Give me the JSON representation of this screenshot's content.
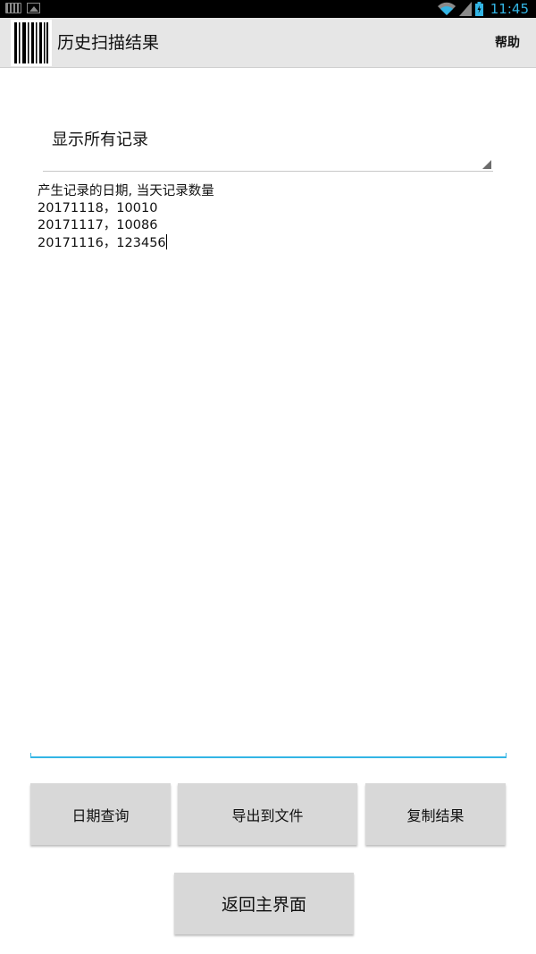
{
  "status_bar": {
    "time": "11:45",
    "icons": [
      "keyboard-icon",
      "image-icon",
      "wifi-icon",
      "signal-icon",
      "battery-icon"
    ],
    "accent_color": "#33b5e5"
  },
  "action_bar": {
    "title": "历史扫描结果",
    "help_label": "帮助",
    "logo_icon": "barcode-icon"
  },
  "spinner": {
    "selected": "显示所有记录"
  },
  "records": {
    "header": "产生记录的日期, 当天记录数量",
    "rows": [
      "20171118，10010",
      "20171117，10086",
      "20171116，123456"
    ]
  },
  "buttons": {
    "date_query": "日期查询",
    "export_file": "导出到文件",
    "copy_result": "复制结果",
    "back_main": "返回主界面"
  }
}
